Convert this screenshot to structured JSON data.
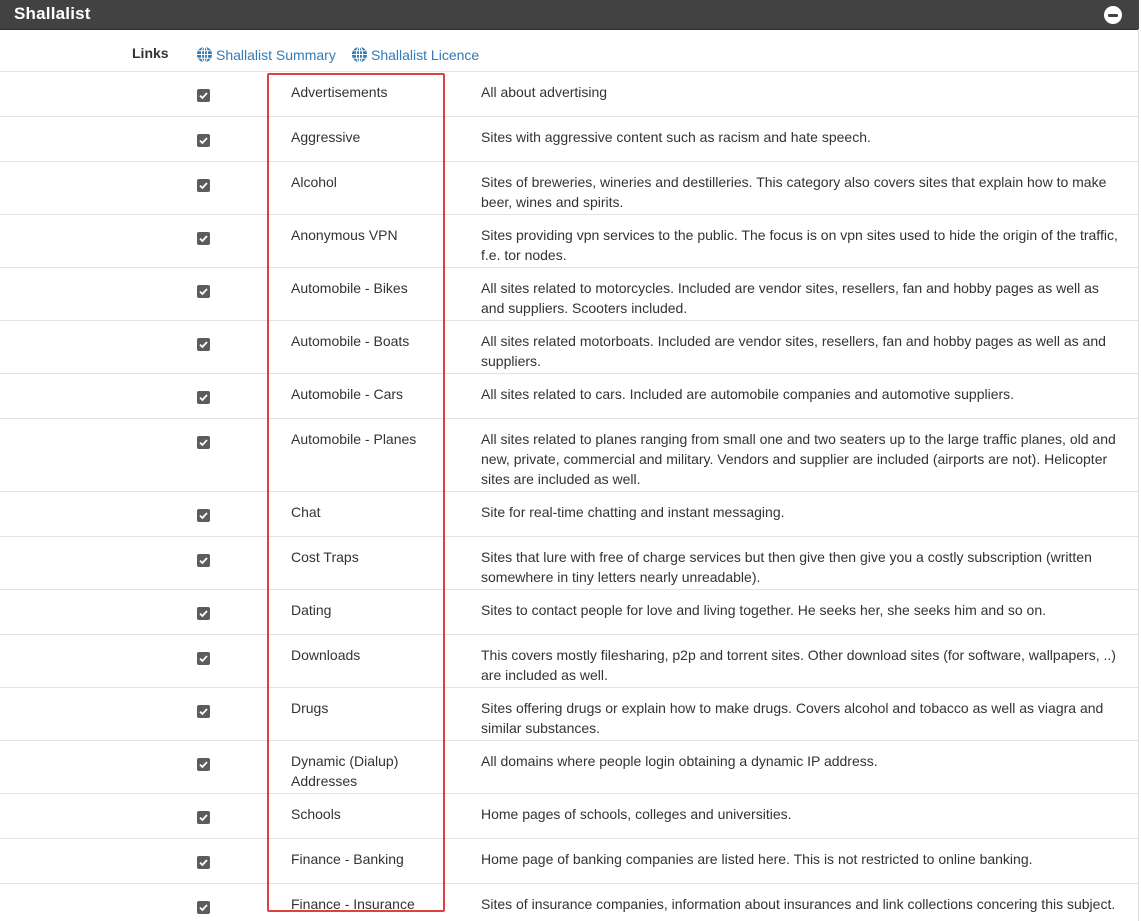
{
  "panel": {
    "title": "Shallalist"
  },
  "links": {
    "label": "Links",
    "items": [
      "Shallalist Summary",
      "Shallalist Licence"
    ]
  },
  "categories": [
    {
      "name": "Advertisements",
      "description": "All about advertising",
      "checked": true
    },
    {
      "name": "Aggressive",
      "description": "Sites with aggressive content such as racism and hate speech.",
      "checked": true
    },
    {
      "name": "Alcohol",
      "description": "Sites of breweries, wineries and destilleries. This category also covers sites that explain how to make beer, wines and spirits.",
      "checked": true
    },
    {
      "name": "Anonymous VPN",
      "description": "Sites providing vpn services to the public. The focus is on vpn sites used to hide the origin of the traffic, f.e. tor nodes.",
      "checked": true
    },
    {
      "name": "Automobile - Bikes",
      "description": "All sites related to motorcycles. Included are vendor sites, resellers, fan and hobby pages as well as and suppliers. Scooters included.",
      "checked": true
    },
    {
      "name": "Automobile - Boats",
      "description": "All sites related motorboats. Included are vendor sites, resellers, fan and hobby pages as well as and suppliers.",
      "checked": true
    },
    {
      "name": "Automobile - Cars",
      "description": "All sites related to cars. Included are automobile companies and automotive suppliers.",
      "checked": true
    },
    {
      "name": "Automobile - Planes",
      "description": "All sites related to planes ranging from small one and two seaters up to the large traffic planes, old and new, private, commercial and military. Vendors and supplier are included (airports are not). Helicopter sites are included as well.",
      "checked": true
    },
    {
      "name": "Chat",
      "description": "Site for real-time chatting and instant messaging.",
      "checked": true
    },
    {
      "name": "Cost Traps",
      "description": "Sites that lure with free of charge services but then give then give you a costly subscription (written somewhere in tiny letters nearly unreadable).",
      "checked": true
    },
    {
      "name": "Dating",
      "description": "Sites to contact people for love and living together. He seeks her, she seeks him and so on.",
      "checked": true
    },
    {
      "name": "Downloads",
      "description": "This covers mostly filesharing, p2p and torrent sites. Other download sites (for software, wallpapers, ..) are included as well.",
      "checked": true
    },
    {
      "name": "Drugs",
      "description": "Sites offering drugs or explain how to make drugs. Covers alcohol and tobacco as well as viagra and similar substances.",
      "checked": true
    },
    {
      "name": "Dynamic (Dialup) Addresses",
      "description": "All domains where people login obtaining a dynamic IP address.",
      "checked": true
    },
    {
      "name": "Schools",
      "description": "Home pages of schools, colleges and universities.",
      "checked": true
    },
    {
      "name": "Finance - Banking",
      "description": "Home page of banking companies are listed here. This is not restricted to online banking.",
      "checked": true
    },
    {
      "name": "Finance - Insurance",
      "description": "Sites of insurance companies, information about insurances and link collections concering this subject.",
      "checked": true
    }
  ],
  "colors": {
    "header_bg": "#424242",
    "link": "#337ab7",
    "highlight_border": "#e0403f",
    "checkbox": "#5c5c5c"
  }
}
